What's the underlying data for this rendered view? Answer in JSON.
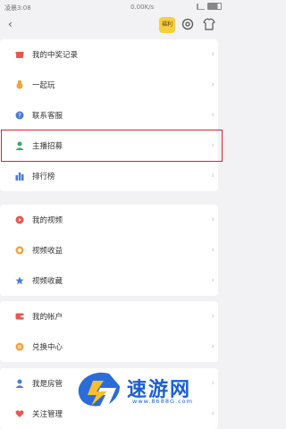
{
  "status_bar": {
    "time": "凌晨3:08",
    "network_speed": "0.00K/s"
  },
  "header": {
    "back_icon": "chevron-left-icon",
    "badge_text": "福利",
    "gear_icon": "gear-icon",
    "shirt_icon": "shirt-icon"
  },
  "sections": [
    {
      "items": [
        {
          "label": "我的中奖记录",
          "icon": "gift-icon",
          "icon_color": "#e8574f"
        },
        {
          "label": "一起玩",
          "icon": "medal-icon",
          "icon_color": "#f0a53a"
        },
        {
          "label": "联系客服",
          "icon": "question-icon",
          "icon_color": "#4a7bd6"
        }
      ]
    },
    {
      "items": [
        {
          "label": "主播招募",
          "icon": "user-icon",
          "icon_color": "#3aa96b",
          "highlighted": true
        },
        {
          "label": "排行榜",
          "icon": "bar-chart-icon",
          "icon_color": "#4a7bd6"
        }
      ]
    },
    {
      "items": [
        {
          "label": "我的视频",
          "icon": "play-icon",
          "icon_color": "#e8574f"
        },
        {
          "label": "视频收益",
          "icon": "coin-icon",
          "icon_color": "#f0a53a"
        },
        {
          "label": "视频收藏",
          "icon": "star-icon",
          "icon_color": "#4a7bd6"
        }
      ]
    },
    {
      "items": [
        {
          "label": "我的帐户",
          "icon": "wallet-icon",
          "icon_color": "#e8574f"
        },
        {
          "label": "兑换中心",
          "icon": "exchange-icon",
          "icon_color": "#f0a53a"
        }
      ]
    },
    {
      "items": [
        {
          "label": "我是房管",
          "icon": "manager-icon",
          "icon_color": "#4a7bd6"
        },
        {
          "label": "关注管理",
          "icon": "heart-icon",
          "icon_color": "#e8574f"
        }
      ]
    }
  ],
  "watermark": {
    "brand": "速游网",
    "url": "www.8688G.com"
  },
  "colors": {
    "background": "#f2f2f4",
    "highlight_border": "#d9232e",
    "watermark_blue": "#1a5fd6"
  }
}
